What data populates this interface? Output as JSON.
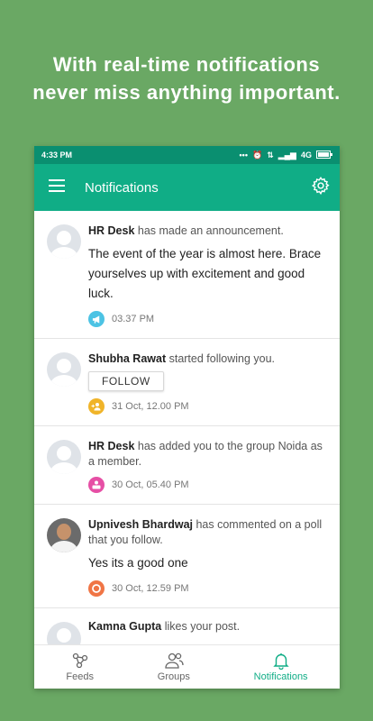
{
  "headline": {
    "line1": "With real-time notifications",
    "line2": "never miss anything important."
  },
  "status_bar": {
    "time": "4:33 PM",
    "network": "4G"
  },
  "app_bar": {
    "title": "Notifications"
  },
  "notifications": [
    {
      "actor": "HR Desk",
      "action": " has made an announcement.",
      "message": "The event of the year is almost here. Brace yourselves up with excitement and good luck.",
      "time": "03.37 PM",
      "badge_color": "#4cc3e4",
      "badge_icon": "megaphone-icon"
    },
    {
      "actor": "Shubha Rawat",
      "action": " started following you.",
      "button": "FOLLOW",
      "time": "31 Oct, 12.00 PM",
      "badge_color": "#f0b429",
      "badge_icon": "add-user-icon"
    },
    {
      "actor": "HR Desk",
      "action": " has added you to the group Noida as a member.",
      "time": "30 Oct, 05.40 PM",
      "badge_color": "#e64fa5",
      "badge_icon": "group-icon"
    },
    {
      "actor": "Upnivesh Bhardwaj",
      "action": " has commented on a poll that you follow.",
      "message": "Yes its a good one",
      "time": "30 Oct, 12.59 PM",
      "badge_color": "#f07545",
      "badge_icon": "comment-icon"
    },
    {
      "actor": "Kamna Gupta",
      "action": " likes your post."
    }
  ],
  "bottom_nav": [
    {
      "label": "Feeds",
      "icon": "feeds-icon"
    },
    {
      "label": "Groups",
      "icon": "groups-icon"
    },
    {
      "label": "Notifications",
      "icon": "bell-icon",
      "active": true
    }
  ],
  "colors": {
    "background": "#6aa864",
    "app_bar": "#10ad86",
    "status_bar": "#0a8f70",
    "accent": "#10ad86"
  }
}
